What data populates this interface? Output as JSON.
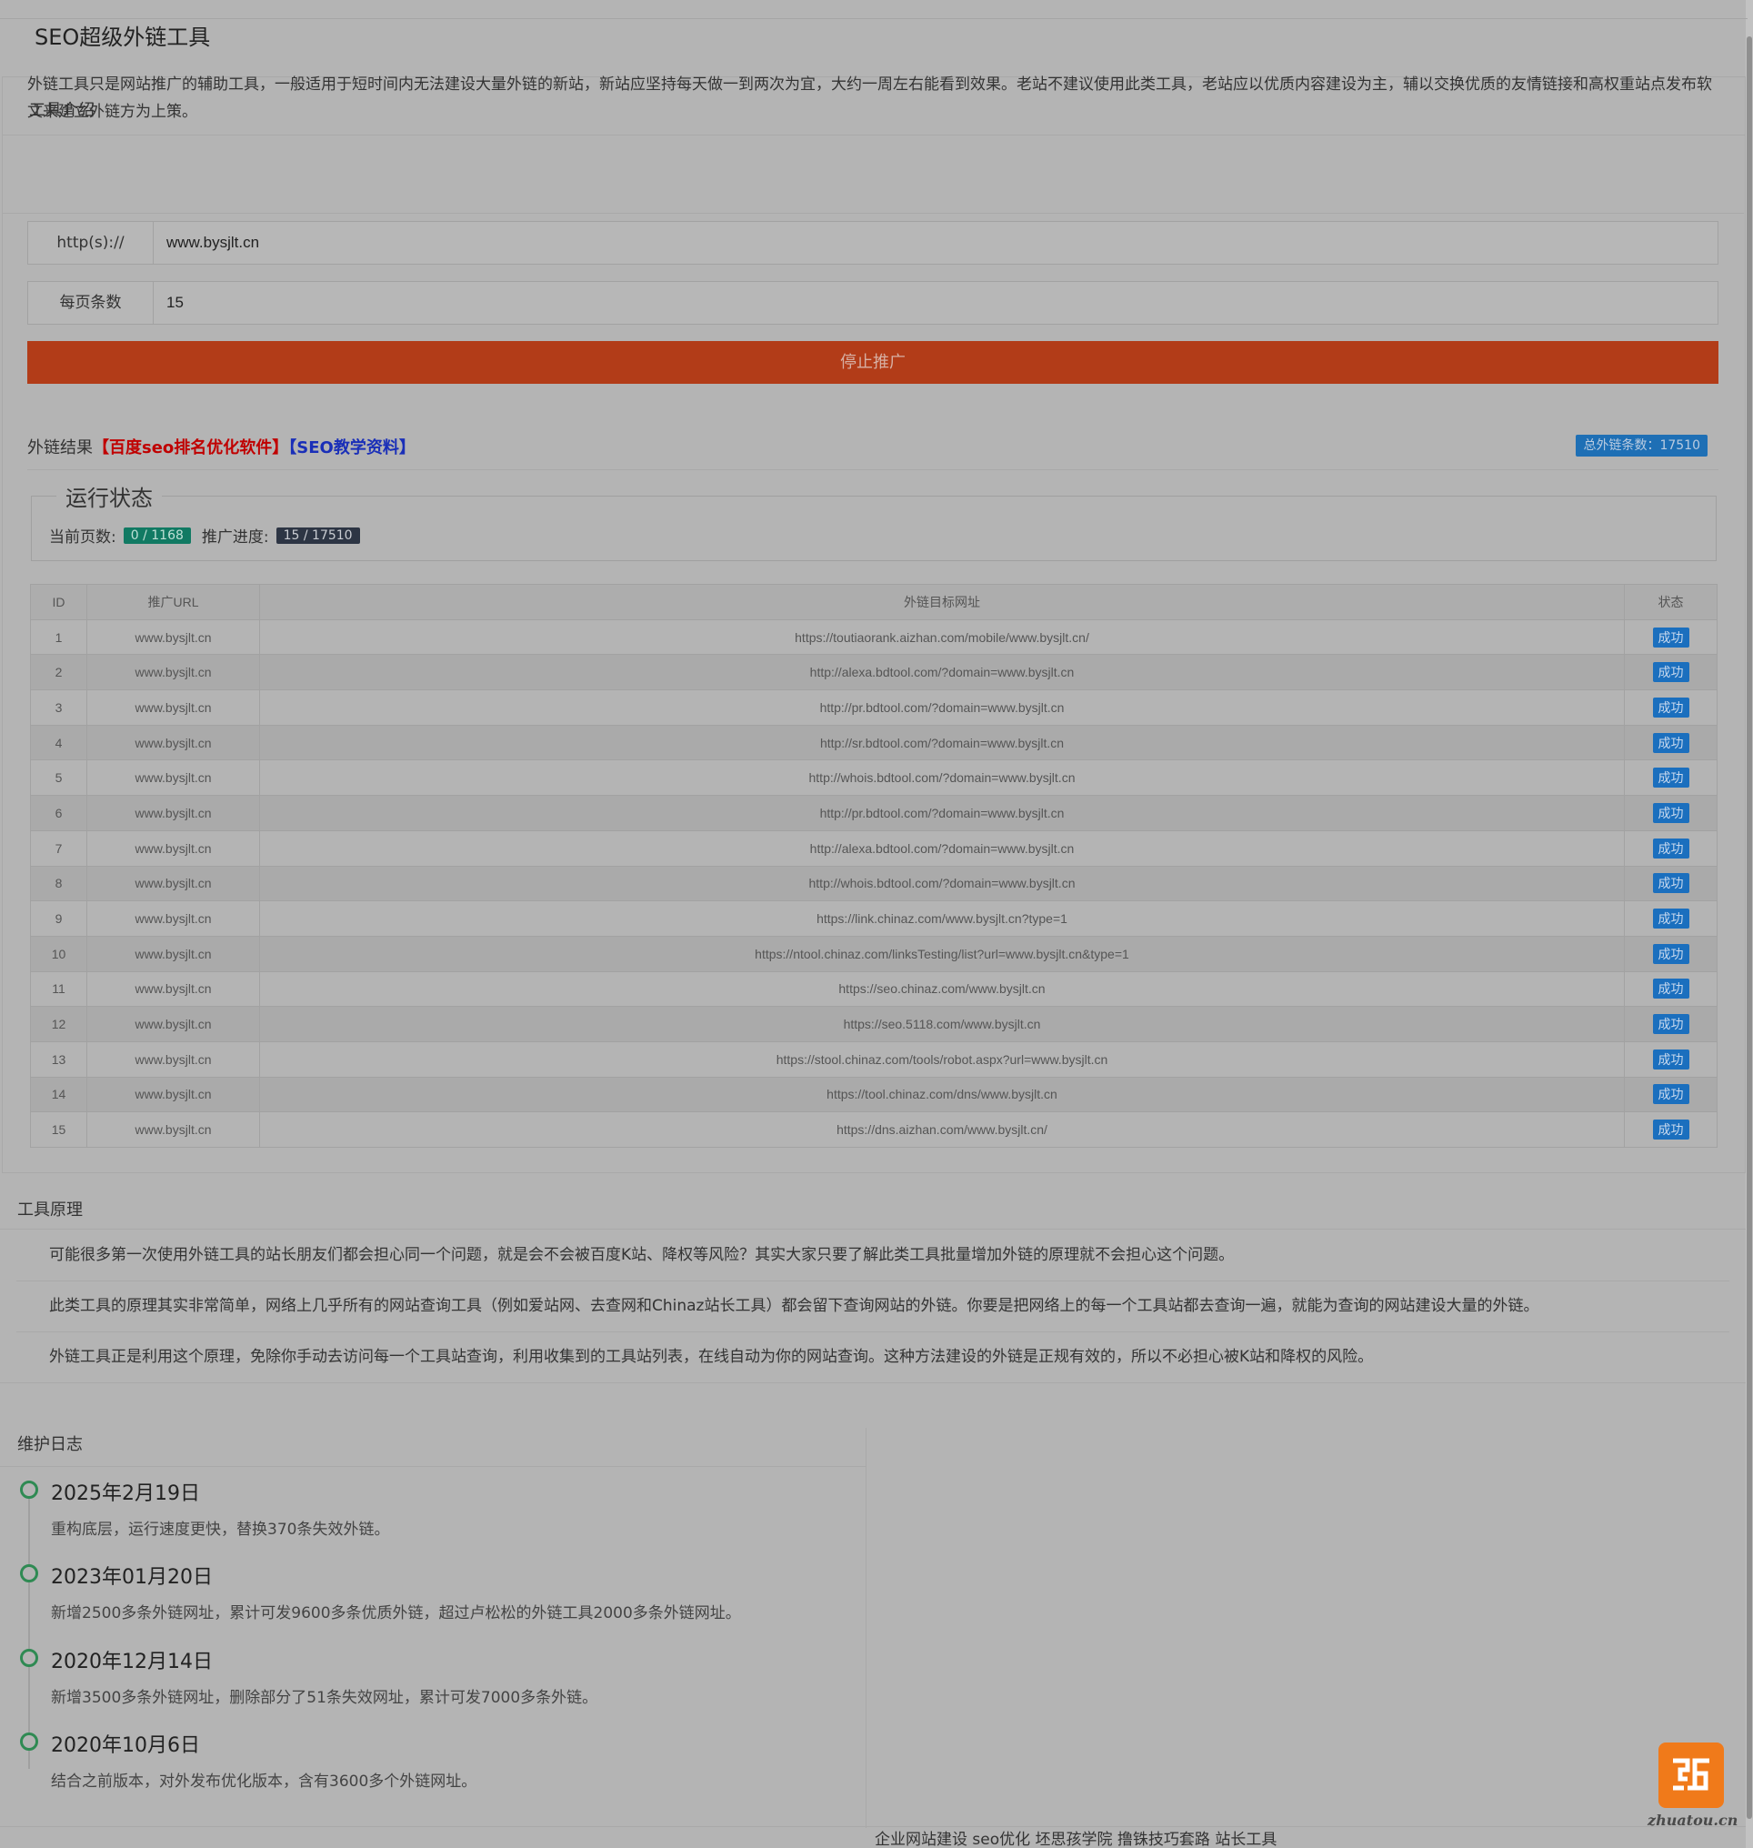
{
  "header": {
    "title": "SEO超级外链工具"
  },
  "intro": {
    "heading": "工具介绍",
    "text": "外链工具只是网站推广的辅助工具，一般适用于短时间内无法建设大量外链的新站，新站应坚持每天做一到两次为宜，大约一周左右能看到效果。老站不建议使用此类工具，老站应以优质内容建设为主，辅以交换优质的友情链接和高权重站点发布软文来建立外链方为上策。"
  },
  "form": {
    "protocol_label": "http(s)://",
    "url_value": "www.bysjlt.cn",
    "per_page_label": "每页条数",
    "per_page_value": "15",
    "stop_button": "停止推广"
  },
  "results": {
    "label": "外链结果",
    "link1": "百度seo排名优化软件",
    "link2": "SEO教学资料",
    "total_badge": "总外链条数：17510"
  },
  "status": {
    "legend": "运行状态",
    "page_label": "当前页数:",
    "page_value": "0 / 1168",
    "progress_label": "推广进度:",
    "progress_value": "15 / 17510"
  },
  "table": {
    "headers": [
      "ID",
      "推广URL",
      "外链目标网址",
      "状态"
    ],
    "rows": [
      {
        "id": "1",
        "url": "www.bysjlt.cn",
        "target": "https://toutiaorank.aizhan.com/mobile/www.bysjlt.cn/",
        "status": "成功"
      },
      {
        "id": "2",
        "url": "www.bysjlt.cn",
        "target": "http://alexa.bdtool.com/?domain=www.bysjlt.cn",
        "status": "成功"
      },
      {
        "id": "3",
        "url": "www.bysjlt.cn",
        "target": "http://pr.bdtool.com/?domain=www.bysjlt.cn",
        "status": "成功"
      },
      {
        "id": "4",
        "url": "www.bysjlt.cn",
        "target": "http://sr.bdtool.com/?domain=www.bysjlt.cn",
        "status": "成功"
      },
      {
        "id": "5",
        "url": "www.bysjlt.cn",
        "target": "http://whois.bdtool.com/?domain=www.bysjlt.cn",
        "status": "成功"
      },
      {
        "id": "6",
        "url": "www.bysjlt.cn",
        "target": "http://pr.bdtool.com/?domain=www.bysjlt.cn",
        "status": "成功"
      },
      {
        "id": "7",
        "url": "www.bysjlt.cn",
        "target": "http://alexa.bdtool.com/?domain=www.bysjlt.cn",
        "status": "成功"
      },
      {
        "id": "8",
        "url": "www.bysjlt.cn",
        "target": "http://whois.bdtool.com/?domain=www.bysjlt.cn",
        "status": "成功"
      },
      {
        "id": "9",
        "url": "www.bysjlt.cn",
        "target": "https://link.chinaz.com/www.bysjlt.cn?type=1",
        "status": "成功"
      },
      {
        "id": "10",
        "url": "www.bysjlt.cn",
        "target": "https://ntool.chinaz.com/linksTesting/list?url=www.bysjlt.cn&type=1",
        "status": "成功"
      },
      {
        "id": "11",
        "url": "www.bysjlt.cn",
        "target": "https://seo.chinaz.com/www.bysjlt.cn",
        "status": "成功"
      },
      {
        "id": "12",
        "url": "www.bysjlt.cn",
        "target": "https://seo.5118.com/www.bysjlt.cn",
        "status": "成功"
      },
      {
        "id": "13",
        "url": "www.bysjlt.cn",
        "target": "https://stool.chinaz.com/tools/robot.aspx?url=www.bysjlt.cn",
        "status": "成功"
      },
      {
        "id": "14",
        "url": "www.bysjlt.cn",
        "target": "https://tool.chinaz.com/dns/www.bysjlt.cn",
        "status": "成功"
      },
      {
        "id": "15",
        "url": "www.bysjlt.cn",
        "target": "https://dns.aizhan.com/www.bysjlt.cn/",
        "status": "成功"
      }
    ]
  },
  "principle": {
    "heading": "工具原理",
    "p1": "可能很多第一次使用外链工具的站长朋友们都会担心同一个问题，就是会不会被百度K站、降权等风险？其实大家只要了解此类工具批量增加外链的原理就不会担心这个问题。",
    "p2": "此类工具的原理其实非常简单，网络上几乎所有的网站查询工具（例如爱站网、去查网和Chinaz站长工具）都会留下查询网站的外链。你要是把网络上的每一个工具站都去查询一遍，就能为查询的网站建设大量的外链。",
    "p3": "外链工具正是利用这个原理，免除你手动去访问每一个工具站查询，利用收集到的工具站列表，在线自动为你的网站查询。这种方法建设的外链是正规有效的，所以不必担心被K站和降权的风险。"
  },
  "log": {
    "heading": "维护日志",
    "entries": [
      {
        "date": "2025年2月19日",
        "text": "重构底层，运行速度更快，替换370条失效外链。"
      },
      {
        "date": "2023年01月20日",
        "text": "新增2500多条外链网址，累计可发9600多条优质外链，超过卢松松的外链工具2000多条外链网址。"
      },
      {
        "date": "2020年12月14日",
        "text": "新增3500多条外链网址，删除部分了51条失效网址，累计可发7000多条外链。"
      },
      {
        "date": "2020年10月6日",
        "text": "结合之前版本，对外发布优化版本，含有3600多个外链网址。"
      }
    ]
  },
  "footer": {
    "links": "企业网站建设 seo优化 坯思孩学院 撸铢技巧套路 站长工具"
  },
  "watermark": {
    "text": "zhuatou.cn"
  },
  "icons": {
    "logo": "zhuatou-logo-icon"
  },
  "colors": {
    "stop_button": "#b23c18",
    "success_badge": "#1b6fbe",
    "page_badge": "#117a63",
    "progress_badge": "#2d3544",
    "timeline_dot": "#2f8a53",
    "logo": "#f07a1a"
  }
}
